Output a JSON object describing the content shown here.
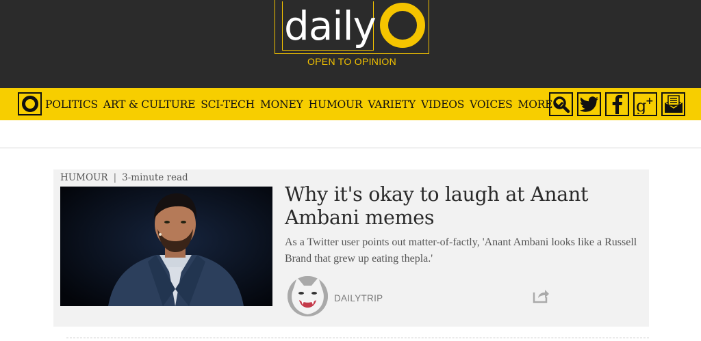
{
  "brand": {
    "logo_text": "daily",
    "tagline": "OPEN TO OPINION"
  },
  "nav": {
    "items": [
      {
        "label": "POLITICS"
      },
      {
        "label": "ART & CULTURE"
      },
      {
        "label": "SCI-TECH"
      },
      {
        "label": "MONEY"
      },
      {
        "label": "HUMOUR"
      },
      {
        "label": "VARIETY"
      },
      {
        "label": "VIDEOS"
      },
      {
        "label": "VOICES"
      }
    ],
    "more_label": "MORE",
    "icons": [
      "search-icon",
      "twitter-icon",
      "facebook-icon",
      "google-plus-icon",
      "newsletter-icon"
    ]
  },
  "article": {
    "category": "HUMOUR",
    "separator": "|",
    "read_time": "3-minute read",
    "headline": "Why it's okay to laugh at Anant Ambani memes",
    "summary": "As a Twitter user points out matter-of-factly, 'Anant Ambani looks like a Russell Brand that grew up eating thepla.'",
    "author": "DAILYTRIP"
  },
  "colors": {
    "header_bg": "#2b2b2b",
    "accent": "#f7ce00",
    "card_bg": "#f2f2f2"
  }
}
